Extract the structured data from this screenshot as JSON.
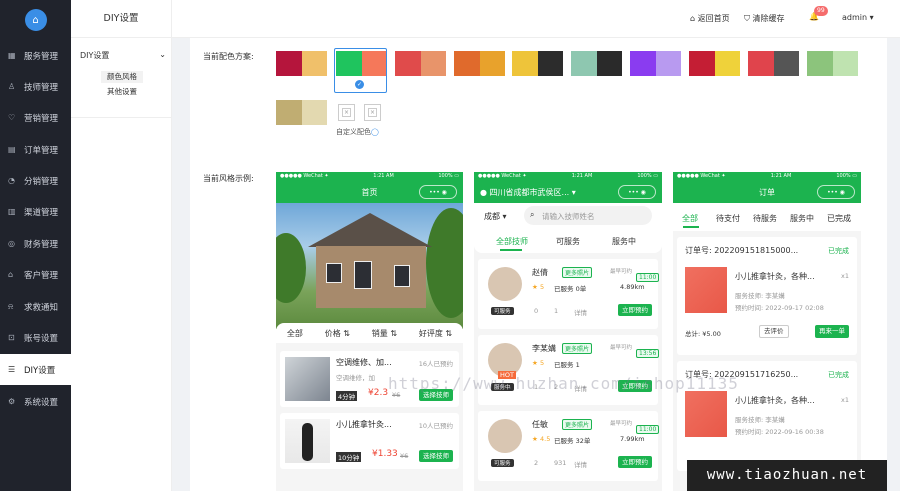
{
  "side": {
    "items": [
      {
        "icon": "▦",
        "label": "服务管理"
      },
      {
        "icon": "♙",
        "label": "技师管理"
      },
      {
        "icon": "♡",
        "label": "营销管理"
      },
      {
        "icon": "▤",
        "label": "订单管理"
      },
      {
        "icon": "◔",
        "label": "分销管理"
      },
      {
        "icon": "▥",
        "label": "渠道管理"
      },
      {
        "icon": "◎",
        "label": "财务管理"
      },
      {
        "icon": "⌂",
        "label": "客户管理"
      },
      {
        "icon": "⍾",
        "label": "求救通知"
      },
      {
        "icon": "⊡",
        "label": "账号设置"
      },
      {
        "icon": "☰",
        "label": "DIY设置"
      },
      {
        "icon": "⚙",
        "label": "系统设置"
      }
    ]
  },
  "sub": {
    "title": "DIY设置",
    "group": "DIY设置",
    "arrow": "⌄",
    "items": [
      "颜色风格",
      "其他设置"
    ]
  },
  "top": {
    "home": "返回首页",
    "cache": "清除缓存",
    "badge": "99",
    "user": "admin",
    "home_icon": "⌂",
    "cache_icon": "⛉",
    "bell_icon": "🔔",
    "caret": "▾"
  },
  "main": {
    "scheme_label": "当前配色方案:",
    "style_label": "当前风格示例:",
    "custom_label": "自定义配色",
    "custom_icon": "◯",
    "check": "✓",
    "x": "×"
  },
  "colors": {
    "swatches": [
      [
        "#b5153c",
        "#f0c06a"
      ],
      [
        "#1fc45e",
        "#f5785a"
      ],
      [
        "#e04b4b",
        "#e8946a"
      ],
      [
        "#e06a2c",
        "#e8a22c"
      ],
      [
        "#eec43a",
        "#2c2c2c"
      ],
      [
        "#8ec7b0",
        "#2a2a2a"
      ],
      [
        "#8a3cf0",
        "#b89af0"
      ],
      [
        "#c41e34",
        "#efd23a"
      ],
      [
        "#e0444c",
        "#555555"
      ],
      [
        "#8cc47c",
        "#bfe3b0"
      ],
      [
        "#c0ad72",
        "#e3d9b0"
      ]
    ],
    "green": "#1cb34f"
  },
  "phone": {
    "status_left": "●●●●● WeChat ✦",
    "status_time": "1:21 AM",
    "status_right": "100% ▭",
    "cap": "•••  ◉"
  },
  "p1": {
    "title": "首页",
    "filters": [
      "全部",
      "价格 ⇅",
      "销量 ⇅",
      "好评度 ⇅"
    ],
    "cards": [
      {
        "title": "空调维修、加...",
        "sub": "空调维修，加",
        "booked": "16人已预约",
        "time": "4分钟",
        "price": "¥2.3",
        "old": "¥6",
        "btn": "选择技师"
      },
      {
        "title": "小儿推拿针灸...",
        "booked": "10人已预约",
        "time": "10分钟",
        "price": "¥1.33",
        "old": "¥6",
        "btn": "选择技师"
      }
    ]
  },
  "p2": {
    "loc": "四川省成都市武侯区...",
    "loc_caret": "▾",
    "loc_icon": "●",
    "city": "成都",
    "city_caret": "▾",
    "search_icon": "⌕",
    "search_ph": "请输入技师姓名",
    "tabs": [
      "全部技师",
      "可服务",
      "服务中"
    ],
    "techs": [
      {
        "name": "赵倩",
        "tag": "更多照片",
        "avail": "最早可约",
        "time": "11:00",
        "rating": "5",
        "served": "已服务 0单",
        "dist": "4.89km",
        "status": "可服务",
        "likes": "0",
        "comments": "1",
        "detail": "详情",
        "btn": "立即预约",
        "hot": ""
      },
      {
        "name": "李某媾",
        "tag": "更多照片",
        "avail": "最早可约",
        "time": "13:56",
        "rating": "5",
        "served": "已服务 1",
        "dist": "",
        "status": "服务中",
        "likes": "1",
        "comments": "2",
        "detail": "详情",
        "btn": "立即预约",
        "hot": "HOT"
      },
      {
        "name": "任敏",
        "tag": "更多照片",
        "avail": "最早可约",
        "time": "11:00",
        "rating": "4.5",
        "served": "已服务 32单",
        "dist": "7.99km",
        "status": "可服务",
        "likes": "2",
        "comments": "931",
        "detail": "详情",
        "btn": "立即预约",
        "hot": ""
      }
    ]
  },
  "p3": {
    "title": "订单",
    "tabs": [
      "全部",
      "待支付",
      "待服务",
      "服务中",
      "已完成"
    ],
    "orders": [
      {
        "no": "订单号: 202209151815000...",
        "state": "已完成",
        "name": "小儿推拿针灸，各种...",
        "qty": "x1",
        "tech": "服务技师: 李某媾",
        "appt": "预约时间: 2022-09-17 02:08",
        "total": "总计: ¥5.00",
        "b1": "去评价",
        "b2": "再来一单"
      },
      {
        "no": "订单号: 202209151716250...",
        "state": "已完成",
        "name": "小儿推拿针灸，各种...",
        "qty": "x1",
        "tech": "服务技师: 李某媾",
        "appt": "预约时间: 2022-09-16 00:38"
      }
    ]
  },
  "watermark": "https://www.huzhan.com/ishop11135",
  "watermark2": "www.tiaozhuan.net"
}
